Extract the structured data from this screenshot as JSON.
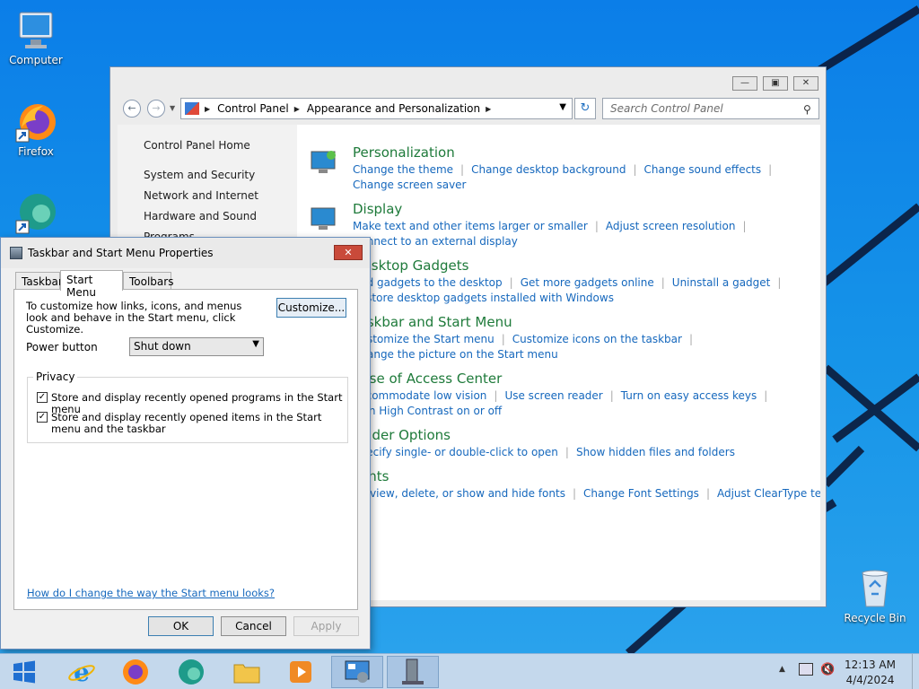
{
  "desktop": {
    "icons": [
      {
        "label": "Computer"
      },
      {
        "label": "Firefox"
      },
      {
        "label": "Recycle Bin"
      }
    ]
  },
  "control_panel": {
    "address": {
      "segments": [
        "Control Panel",
        "Appearance and Personalization"
      ]
    },
    "search_placeholder": "Search Control Panel",
    "sidebar": {
      "home": "Control Panel Home",
      "items": [
        "System and Security",
        "Network and Internet",
        "Hardware and Sound",
        "Programs"
      ]
    },
    "categories": [
      {
        "title": "Personalization",
        "links": [
          "Change the theme",
          "Change desktop background",
          "Change sound effects",
          "Change screen saver"
        ]
      },
      {
        "title": "Display",
        "links": [
          "Make text and other items larger or smaller",
          "Adjust screen resolution",
          "Connect to an external display"
        ]
      },
      {
        "title": "Desktop Gadgets",
        "links": [
          "Add gadgets to the desktop",
          "Get more gadgets online",
          "Uninstall a gadget",
          "Restore desktop gadgets installed with Windows"
        ]
      },
      {
        "title": "Taskbar and Start Menu",
        "links": [
          "Customize the Start menu",
          "Customize icons on the taskbar",
          "Change the picture on the Start menu"
        ]
      },
      {
        "title": "Ease of Access Center",
        "links": [
          "Accommodate low vision",
          "Use screen reader",
          "Turn on easy access keys",
          "Turn High Contrast on or off"
        ]
      },
      {
        "title": "Folder Options",
        "links": [
          "Specify single- or double-click to open",
          "Show hidden files and folders"
        ]
      },
      {
        "title": "Fonts",
        "links": [
          "Preview, delete, or show and hide fonts",
          "Change Font Settings",
          "Adjust ClearType text"
        ]
      }
    ]
  },
  "dialog": {
    "title": "Taskbar and Start Menu Properties",
    "tabs": [
      "Taskbar",
      "Start Menu",
      "Toolbars"
    ],
    "active_tab": "Start Menu",
    "description": "To customize how links, icons, and menus look and behave in the Start menu, click Customize.",
    "customize_label": "Customize...",
    "power_button_label": "Power button",
    "power_button_value": "Shut down",
    "privacy_legend": "Privacy",
    "checkbox1": {
      "label": "Store and display recently opened programs in the Start menu",
      "checked": true
    },
    "checkbox2": {
      "label": "Store and display recently opened items in the Start menu and the taskbar",
      "checked": true
    },
    "help_link": "How do I change the way the Start menu looks?",
    "ok_label": "OK",
    "cancel_label": "Cancel",
    "apply_label": "Apply"
  },
  "taskbar": {
    "apps": [
      "start-icon",
      "internet-explorer-icon",
      "firefox-icon",
      "edge-icon",
      "file-explorer-icon",
      "media-player-icon",
      "control-panel-icon",
      "taskbar-properties-icon"
    ],
    "time": "12:13 AM",
    "date": "4/4/2024"
  },
  "colors": {
    "link": "#1668bd",
    "category_title": "#1e7a3a",
    "desktop": "#1694e8"
  }
}
